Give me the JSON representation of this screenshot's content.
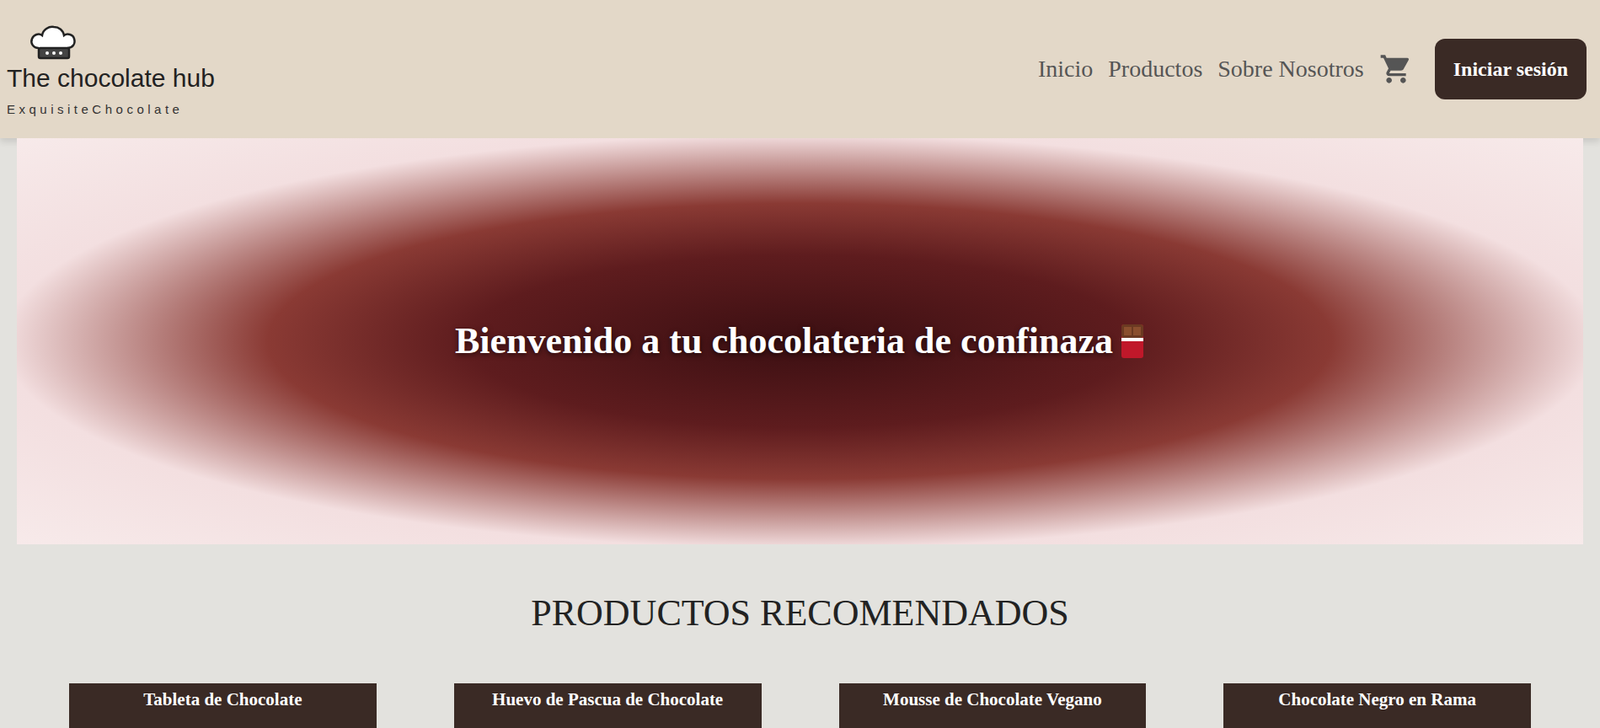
{
  "brand": {
    "name": "The chocolate hub",
    "tagline": "ExquisiteChocolate"
  },
  "nav": [
    {
      "label": "Inicio"
    },
    {
      "label": "Productos"
    },
    {
      "label": "Sobre Nosotros"
    }
  ],
  "login_button": "Iniciar sesión",
  "hero": {
    "title": "Bienvenido a tu chocolateria de confinaza"
  },
  "section": {
    "title": "PRODUCTOS RECOMENDADOS"
  },
  "products": [
    {
      "name": "Tableta de Chocolate"
    },
    {
      "name": "Huevo de Pascua de Chocolate"
    },
    {
      "name": "Mousse de Chocolate Vegano"
    },
    {
      "name": "Chocolate Negro en Rama"
    }
  ]
}
